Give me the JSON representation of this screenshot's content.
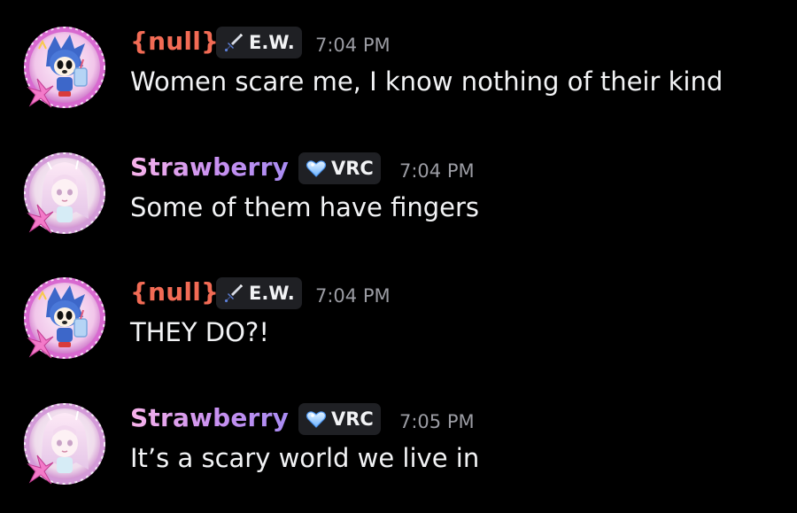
{
  "colors": {
    "background": "#000000",
    "null_name": "#f26b55",
    "strawberry_name_gradient": [
      "#f8b3ea",
      "#c790f0",
      "#a88cf2"
    ],
    "tag_bg": "#1f2024",
    "timestamp": "#9b9ca3",
    "message_text": "#f2f3f5"
  },
  "messages": [
    {
      "author": "{null}",
      "tag": "E.W.",
      "tag_icon": "sword-icon",
      "time": "7:04 PM",
      "text": "Women scare me, I know nothing of their kind",
      "avatar": "avatar-null"
    },
    {
      "author": "Strawberry",
      "tag": "VRC",
      "tag_icon": "heart-icon",
      "time": "7:04 PM",
      "text": "Some of them have fingers",
      "avatar": "avatar-strawberry"
    },
    {
      "author": "{null}",
      "tag": "E.W.",
      "tag_icon": "sword-icon",
      "time": "7:04 PM",
      "text": "THEY DO?!",
      "avatar": "avatar-null"
    },
    {
      "author": "Strawberry",
      "tag": "VRC",
      "tag_icon": "heart-icon",
      "time": "7:05 PM",
      "text": "It’s a scary world we live in",
      "avatar": "avatar-strawberry"
    }
  ]
}
